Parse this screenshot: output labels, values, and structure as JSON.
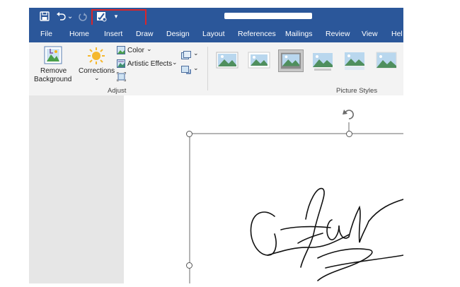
{
  "quick_access": {
    "icons": [
      "save-icon",
      "undo-icon",
      "undo-dropdown-icon",
      "redo-icon",
      "custom-macro-icon",
      "customize-qat-icon"
    ],
    "undo_chevron": "⌄",
    "customize_glyph": "▾"
  },
  "menu": {
    "tabs": [
      "File",
      "Home",
      "Insert",
      "Draw",
      "Design",
      "Layout",
      "References",
      "Mailings",
      "Review",
      "View",
      "Hel"
    ]
  },
  "ribbon": {
    "remove_background": [
      "Remove",
      "Background"
    ],
    "corrections": "Corrections",
    "color": "Color",
    "artistic_effects": "Artistic Effects",
    "adjust_label": "Adjust",
    "picture_styles_label": "Picture Styles",
    "dropdown_glyph": "⌄"
  },
  "colors": {
    "brand": "#2b579a",
    "highlight": "#d9252a",
    "ribbon": "#f3f3f3",
    "canvas": "#e6e6e6"
  }
}
